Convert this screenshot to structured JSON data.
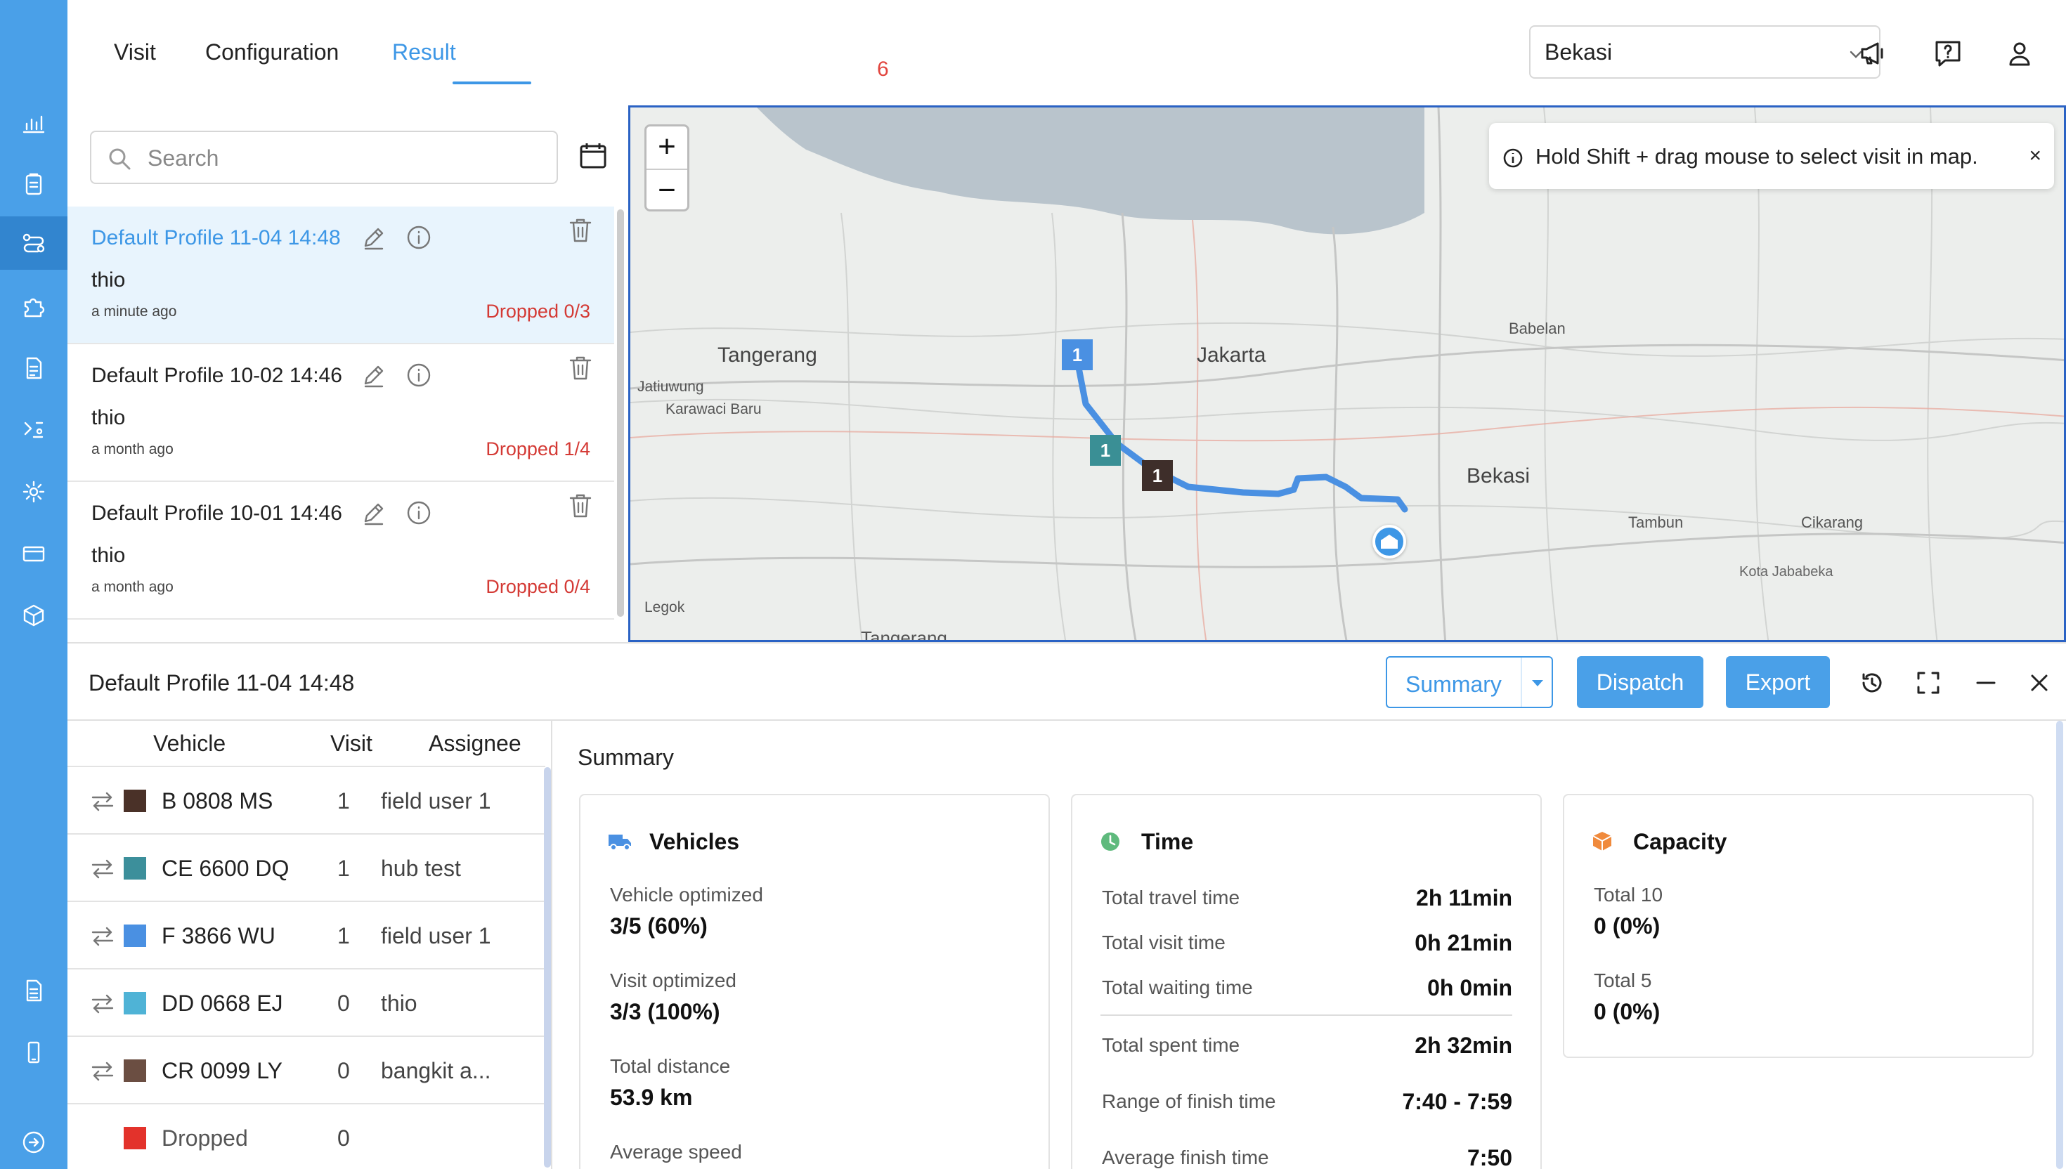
{
  "header": {
    "tabs": [
      {
        "label": "Visit"
      },
      {
        "label": "Configuration"
      },
      {
        "label": "Result"
      }
    ],
    "badge_count": "6",
    "city_select": {
      "value": "Bekasi"
    }
  },
  "sidebar": {
    "icons": [
      "bar-chart-icon",
      "clipboard-icon",
      "route-icon",
      "puzzle-icon",
      "document-icon",
      "settings-flow-icon",
      "gear-icon",
      "credit-card-icon",
      "box-icon",
      "file-text-icon",
      "mobile-icon",
      "logout-icon"
    ]
  },
  "search": {
    "placeholder": "Search",
    "value": ""
  },
  "profiles": [
    {
      "title": "Default Profile 11-04 14:48",
      "user": "thio",
      "time": "a minute ago",
      "dropped": "Dropped 0/3"
    },
    {
      "title": "Default Profile 10-02 14:46",
      "user": "thio",
      "time": "a month ago",
      "dropped": "Dropped 1/4"
    },
    {
      "title": "Default Profile 10-01 14:46",
      "user": "thio",
      "time": "a month ago",
      "dropped": "Dropped 0/4"
    }
  ],
  "map": {
    "hint": "Hold Shift + drag mouse to select visit in map.",
    "hint_close": "×",
    "zoom_in": "+",
    "zoom_out": "−",
    "labels": {
      "jakarta": "Jakarta",
      "tangerang": "Tangerang",
      "bekasi": "Bekasi",
      "babelan": "Babelan",
      "jatiuwung": "Jatiuwung",
      "karawaci": "Karawaci Baru",
      "tambun": "Tambun",
      "cikarang": "Cikarang",
      "legok": "Legok",
      "tangerang2": "Tangerang",
      "kota_jababeka": "Kota Jababeka"
    },
    "markers": [
      {
        "label": "1",
        "color": "#4a90e2"
      },
      {
        "label": "1",
        "color": "#3a8f95"
      },
      {
        "label": "1",
        "color": "#3e2e2a"
      }
    ],
    "route_color": "#4a90e2"
  },
  "bottom": {
    "title": "Default Profile 11-04 14:48",
    "summary_select": "Summary",
    "dispatch_label": "Dispatch",
    "export_label": "Export"
  },
  "vehicle_table": {
    "headers": {
      "vehicle": "Vehicle",
      "visit": "Visit",
      "assignee": "Assignee"
    },
    "rows": [
      {
        "name": "B 0808 MS",
        "visits": "1",
        "assignee": "field user 1",
        "color": "#4a3128"
      },
      {
        "name": "CE 6600 DQ",
        "visits": "1",
        "assignee": "hub test",
        "color": "#3c8f9b"
      },
      {
        "name": "F 3866 WU",
        "visits": "1",
        "assignee": "field user 1",
        "color": "#4a90e2"
      },
      {
        "name": "DD 0668 EJ",
        "visits": "0",
        "assignee": "thio",
        "color": "#4fb3d6"
      },
      {
        "name": "CR 0099 LY",
        "visits": "0",
        "assignee": "bangkit a...",
        "color": "#6b4e42"
      },
      {
        "name": "Dropped",
        "visits": "0",
        "assignee": "",
        "color": "#e3322b"
      }
    ]
  },
  "summary": {
    "title": "Summary",
    "vehicles": {
      "title": "Vehicles",
      "vehicle_optimized_label": "Vehicle optimized",
      "vehicle_optimized": "3/5 (60%)",
      "visit_optimized_label": "Visit optimized",
      "visit_optimized": "3/3 (100%)",
      "total_distance_label": "Total distance",
      "total_distance": "53.9 km",
      "average_speed_label": "Average speed"
    },
    "time": {
      "title": "Time",
      "rows": [
        {
          "label": "Total travel time",
          "value": "2h 11min"
        },
        {
          "label": "Total visit time",
          "value": "0h 21min"
        },
        {
          "label": "Total waiting time",
          "value": "0h 0min"
        },
        {
          "label": "Total spent time",
          "value": "2h 32min"
        },
        {
          "label": "Range of finish time",
          "value": "7:40 - 7:59"
        },
        {
          "label": "Average finish time",
          "value": "7:50"
        }
      ]
    },
    "capacity": {
      "title": "Capacity",
      "items": [
        {
          "label": "Total 10",
          "value": "0 (0%)"
        },
        {
          "label": "Total 5",
          "value": "0 (0%)"
        }
      ]
    }
  }
}
